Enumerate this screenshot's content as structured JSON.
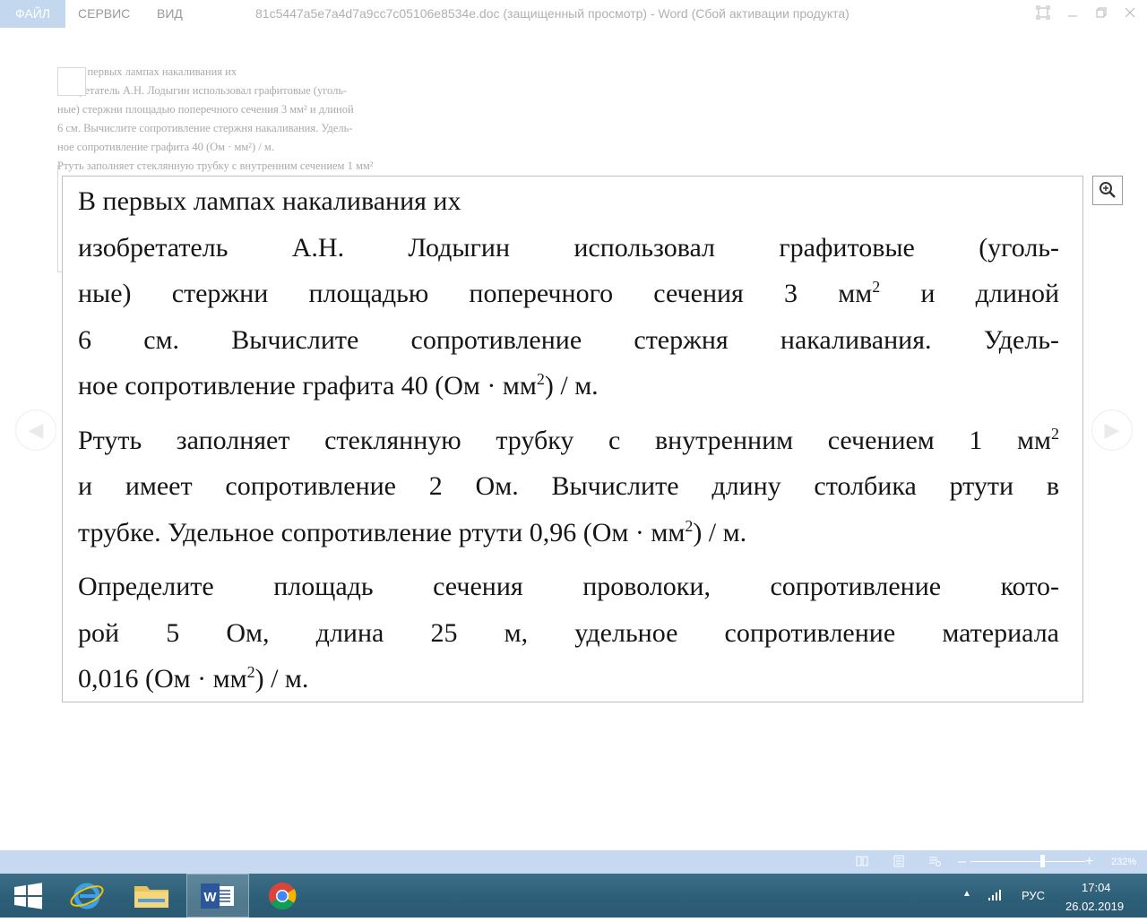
{
  "titlebar": {
    "tabs": [
      "ФАЙЛ",
      "СЕРВИС",
      "ВИД"
    ],
    "title": "81c5447a5e7a4d7a9cc7c05106e8534e.doc (защищенный просмотр) - Word (Сбой активации продукта)"
  },
  "background_doc": {
    "lines": [
      "В первых лампах накаливания их",
      "изобретатель А.Н. Лодыгин использовал графитовые (уголь-",
      "ные) стержни площадью поперечного сечения 3 мм² и длиной",
      "6 см. Вычислите сопротивление стержня накаливания. Удель-",
      "ное сопротивление графита 40 (Ом · мм²) / м.",
      "Ртуть заполняет стеклянную трубку с внутренним сечением 1 мм²"
    ]
  },
  "panel": {
    "p1": {
      "l1": "В первых лампах накаливания их",
      "l2": "изобретатель А.Н. Лодыгин использовал графитовые (уголь-",
      "l3a": "ные) стержни площадью поперечного сечения 3 мм",
      "l3b": " и длиной",
      "l4": "6 см. Вычислите сопротивление стержня накаливания. Удель-",
      "l5a": "ное сопротивление графита 40 (Ом · мм",
      "l5b": ") / м."
    },
    "p2": {
      "l1a": "Ртуть заполняет стеклянную трубку с внутренним сечением 1 мм",
      "l2": "и имеет сопротивление 2 Ом. Вычислите длину столбика ртути в",
      "l3a": "трубке. Удельное сопротивление ртути 0,96 (Ом · мм",
      "l3b": ") / м."
    },
    "p3": {
      "l1": "Определите площадь сечения проволоки, сопротивление кото-",
      "l2": "рой 5 Ом, длина 25 м, удельное сопротивление материала",
      "l3a": "0,016 (Ом · мм",
      "l3b": ") / м."
    },
    "sup": "2"
  },
  "statusbar": {
    "zoom": "232%",
    "zoom_level_percent": 232
  },
  "taskbar": {
    "apps": [
      "start-icon",
      "internet-explorer-icon",
      "file-explorer-icon",
      "word-icon",
      "chrome-icon"
    ],
    "language": "РУС",
    "time": "17:04",
    "date": "26.02.2019"
  },
  "colors": {
    "file_tab": "#c3d7ef",
    "statusbar": "#c6d9f0",
    "taskbar": "#2c5e78"
  }
}
